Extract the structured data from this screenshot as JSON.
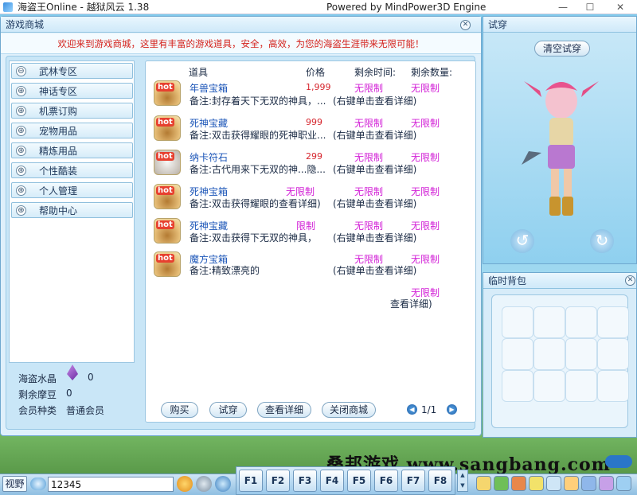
{
  "window": {
    "title": "海盗王Online - 越狱风云 1.38",
    "engine": "Powered by MindPower3D Engine",
    "min": "—",
    "max": "☐",
    "close": "✕"
  },
  "shop": {
    "title": "游戏商城",
    "welcome": "欢迎来到游戏商城，这里有丰富的游戏道具，安全，高效，为您的海盗生涯带来无限可能！",
    "categories": [
      {
        "label": "武林专区",
        "expand": "⊖"
      },
      {
        "label": "神话专区",
        "expand": "⊕"
      },
      {
        "label": "机票订购",
        "expand": "⊕"
      },
      {
        "label": "宠物用品",
        "expand": "⊕"
      },
      {
        "label": "精炼用品",
        "expand": "⊕"
      },
      {
        "label": "个性酷装",
        "expand": "⊕"
      },
      {
        "label": "个人管理",
        "expand": "⊕"
      },
      {
        "label": "帮助中心",
        "expand": "⊕"
      }
    ],
    "stats": {
      "crystal_label": "海盗水晶",
      "crystal_value": "0",
      "bean_label": "剩余摩豆",
      "bean_value": "0",
      "member_label": "会员种类",
      "member_value": "普通会员"
    },
    "columns": {
      "item": "道具",
      "price": "价格",
      "time": "剩余时间:",
      "qty": "剩余数量:"
    },
    "items": [
      {
        "name": "年兽宝箱",
        "note": "备注:封存着天下无双的神具，...",
        "price": "1,999",
        "time": "无限制",
        "qty": "无限制",
        "hint": "(右键单击查看详细)",
        "badge": "hot"
      },
      {
        "name": "死神宝藏",
        "note": "备注:双击获得耀眼的死神职业...",
        "price": "999",
        "time": "无限制",
        "qty": "无限制",
        "hint": "(右键单击查看详细)",
        "badge": "hot"
      },
      {
        "name": "纳卡符石",
        "note": "备注:古代用来下无双的神...隐...",
        "price": "299",
        "time": "无限制",
        "qty": "无限制",
        "hint": "(右键单击查看详细)",
        "badge": "hot"
      },
      {
        "name": "死神宝箱",
        "note": "备注:双击获得耀眼的查看详细)",
        "price": "无限制",
        "time": "无限制",
        "qty": "无限制",
        "hint": "(右键单击查看详细)",
        "badge": "hot"
      },
      {
        "name": "死神宝藏",
        "note": "备注:双击获得下无双的神具，",
        "price": "限制",
        "time": "无限制",
        "qty": "无限制",
        "hint": "(右键单击查看详细)",
        "badge": "hot"
      },
      {
        "name": "魔方宝箱",
        "note": "备注:精致漂亮的",
        "price": "",
        "time": "无限制",
        "qty": "无限制",
        "hint": "(右键单击查看详细)",
        "badge": "hot"
      }
    ],
    "extra_row": {
      "qty": "无限制",
      "hint": "查看详细)"
    },
    "buttons": {
      "buy": "购买",
      "try": "试穿",
      "detail": "查看详细",
      "close_shop": "关闭商城"
    },
    "pager": {
      "text": "1/1",
      "prev": "◀",
      "next": "▶"
    },
    "close": "✕"
  },
  "tryon": {
    "title": "试穿",
    "clear": "清空试穿",
    "rotate_left": "↺",
    "rotate_right": "↻",
    "close": "✕"
  },
  "bag": {
    "title": "临时背包",
    "close": "✕"
  },
  "bottom": {
    "view": "视野",
    "chat_value": "12345",
    "fkeys": [
      "F1",
      "F2",
      "F3",
      "F4",
      "F5",
      "F6",
      "F7",
      "F8"
    ],
    "scroll_up": "▲",
    "scroll_down": "▼",
    "watermark": "桑邦游戏 www.sangbang.com"
  }
}
